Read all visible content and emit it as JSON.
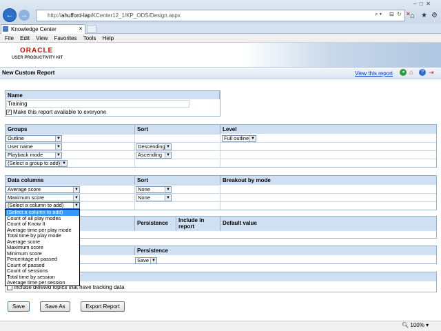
{
  "browser": {
    "url_prefix": "http://",
    "url_host": "ahufford-lap",
    "url_path": "/KCenter12_1/KP_ODS/Design.aspx",
    "tab_label": "Knowledge Center",
    "menu": [
      "File",
      "Edit",
      "View",
      "Favorites",
      "Tools",
      "Help"
    ],
    "zoom": "100%"
  },
  "brand": {
    "logo_text": "ORACLE",
    "product": "USER PRODUCTIVITY KIT",
    "logo_color": "#e00000"
  },
  "page": {
    "title": "New Custom Report",
    "view_link": "View this report"
  },
  "name_section": {
    "header": "Name",
    "value": "Training",
    "checkbox_label": "Make this report available to everyone",
    "checked": true
  },
  "groups_section": {
    "headers": [
      "Groups",
      "Sort",
      "Level"
    ],
    "rows": [
      {
        "group": "Outline",
        "sort": "",
        "level": "Full outline"
      },
      {
        "group": "User name",
        "sort": "Descending",
        "level": ""
      },
      {
        "group": "Playback mode",
        "sort": "Ascending",
        "level": ""
      },
      {
        "group": "(Select a group to add)",
        "sort": "",
        "level": ""
      }
    ]
  },
  "data_section": {
    "headers": [
      "Data columns",
      "Sort",
      "Breakout by mode"
    ],
    "rows": [
      {
        "column": "Average score",
        "sort": "None"
      },
      {
        "column": "Maximum score",
        "sort": "None"
      },
      {
        "column": "(Select a column to add)",
        "sort": ""
      }
    ]
  },
  "dropdown": {
    "options": [
      "(Select a column to add)",
      "Count of all play modes",
      "Count of Know It",
      "Average time per play mode",
      "Total time by play mode",
      "Average score",
      "Maximum score",
      "Minimum score",
      "Percentage of passed",
      "Count of passed",
      "Count of sessions",
      "Total time by session",
      "Average time per session"
    ],
    "highlighted_index": 0
  },
  "filter_section": {
    "headers": [
      "Persistence",
      "Include in report",
      "Default value"
    ]
  },
  "persist_section": {
    "header": "Persistence",
    "value": "Save"
  },
  "options_section": {
    "checkbox_label": "Include deleted topics that have tracking data",
    "checked": false
  },
  "buttons": {
    "save": "Save",
    "save_as": "Save As",
    "export": "Export Report"
  },
  "colors": {
    "header_bg": "#cfe0f2",
    "link": "#0033cc",
    "highlight": "#3399ff"
  }
}
